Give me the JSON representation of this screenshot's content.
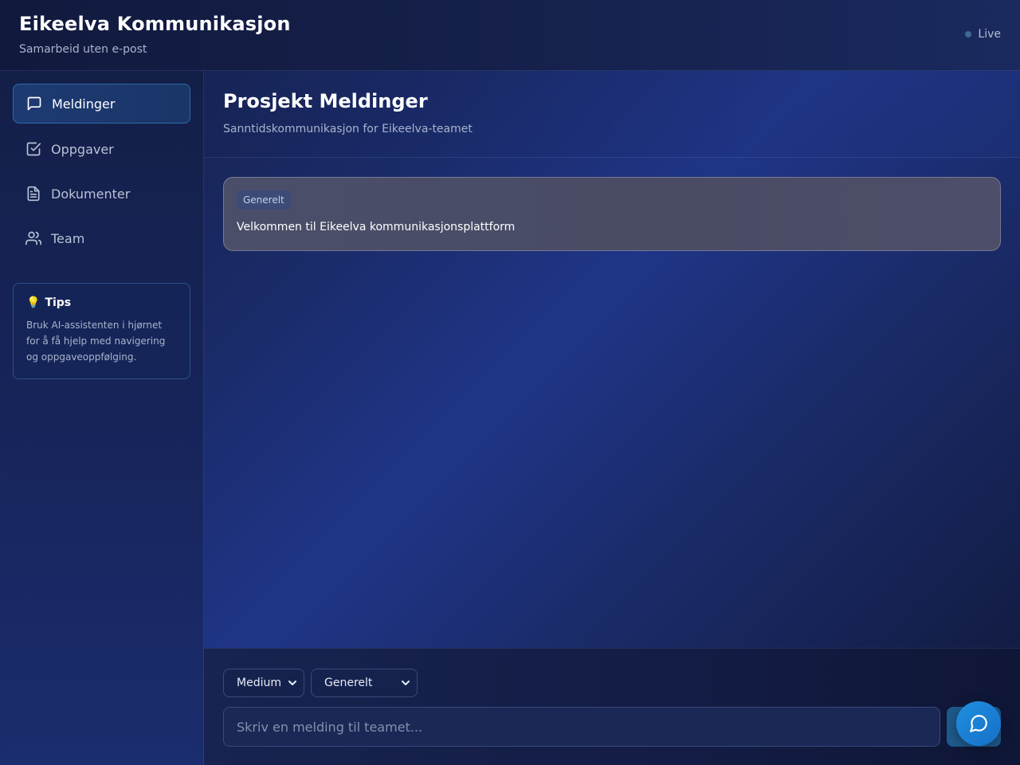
{
  "app": {
    "title": "Eikeelva Kommunikasjon",
    "subtitle": "Samarbeid uten e-post",
    "status": "Live"
  },
  "sidebar": {
    "items": [
      {
        "label": "Meldinger",
        "icon": "message-square-icon",
        "active": true
      },
      {
        "label": "Oppgaver",
        "icon": "check-square-icon",
        "active": false
      },
      {
        "label": "Dokumenter",
        "icon": "file-text-icon",
        "active": false
      },
      {
        "label": "Team",
        "icon": "users-icon",
        "active": false
      }
    ],
    "tips": {
      "icon": "💡",
      "title": "Tips",
      "text": "Bruk AI-assistenten i hjørnet for å få hjelp med navigering og oppgaveoppfølging."
    }
  },
  "main": {
    "title": "Prosjekt Meldinger",
    "subtitle": "Sanntidskommunikasjon for Eikeelva-teamet",
    "messages": [
      {
        "tag": "Generelt",
        "text": "Velkommen til Eikeelva kommunikasjonsplattform"
      }
    ]
  },
  "composer": {
    "priority": "Medium",
    "channel": "Generelt",
    "placeholder": "Skriv en melding til teamet...",
    "ai_icon": "chat-bubble-icon"
  },
  "colors": {
    "accent": "#1f8fe0",
    "active_border": "#2e6aa8",
    "live_dot": "#3d6a8f"
  }
}
